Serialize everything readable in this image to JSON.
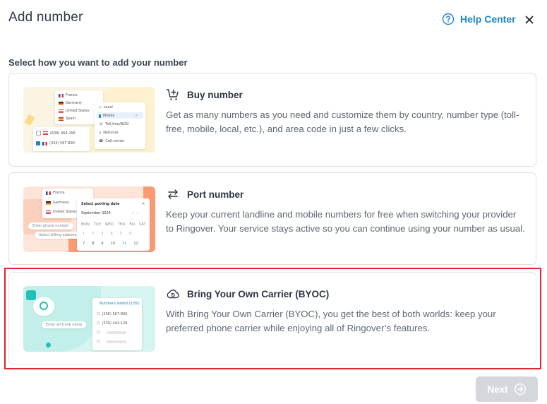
{
  "header": {
    "title": "Add number",
    "help_label": "Help Center"
  },
  "subtitle": "Select how you want to add your number",
  "options": [
    {
      "title": "Buy number",
      "icon": "cart-plus-icon",
      "description": "Get as many numbers as you need and customize them by country, number type (toll-free, mobile, local, etc.), and area code in just a few clicks.",
      "preview": {
        "countries": [
          "France",
          "Germany",
          "United States",
          "Spain"
        ],
        "types": [
          "Local",
          "Mobile",
          "Toll-free/NGN",
          "National",
          "Call-center"
        ],
        "numbers": [
          "(638) 464-256",
          "(334) 567-890"
        ]
      }
    },
    {
      "title": "Port number",
      "icon": "swap-arrows-icon",
      "description": "Keep your current landline and mobile numbers for free when switching your provider to Ringover. Your service stays active so you can continue using your number as usual.",
      "preview": {
        "countries": [
          "France",
          "Germany",
          "United States"
        ],
        "date_title": "Select porting date",
        "month": "September 2024",
        "weekdays": [
          "MON",
          "TUE",
          "WED",
          "THU",
          "FRI",
          "SAT"
        ],
        "days": [
          "1",
          "2",
          "3",
          "4",
          "5",
          "6",
          "7",
          "8",
          "9",
          "10",
          "11",
          "12"
        ],
        "chips": [
          "Enter phone number",
          "Select billing address"
        ]
      }
    },
    {
      "title": "Bring Your Own Carrier (BYOC)",
      "icon": "cloud-sync-icon",
      "description": "With Bring Your Own Carrier (BYOC), you get the best of both worlds: keep your preferred phone carrier while enjoying all of Ringover’s features.",
      "preview": {
        "chip": "Enter all trunk name",
        "list_title": "Numbers added (2/50)",
        "numbers": [
          "(256) 567-890",
          "(339) 442-126"
        ]
      }
    }
  ],
  "footer": {
    "next_label": "Next"
  },
  "colors": {
    "accent": "#1f85c8",
    "highlight": "#e3262b",
    "disabled": "#d4d8dd"
  }
}
